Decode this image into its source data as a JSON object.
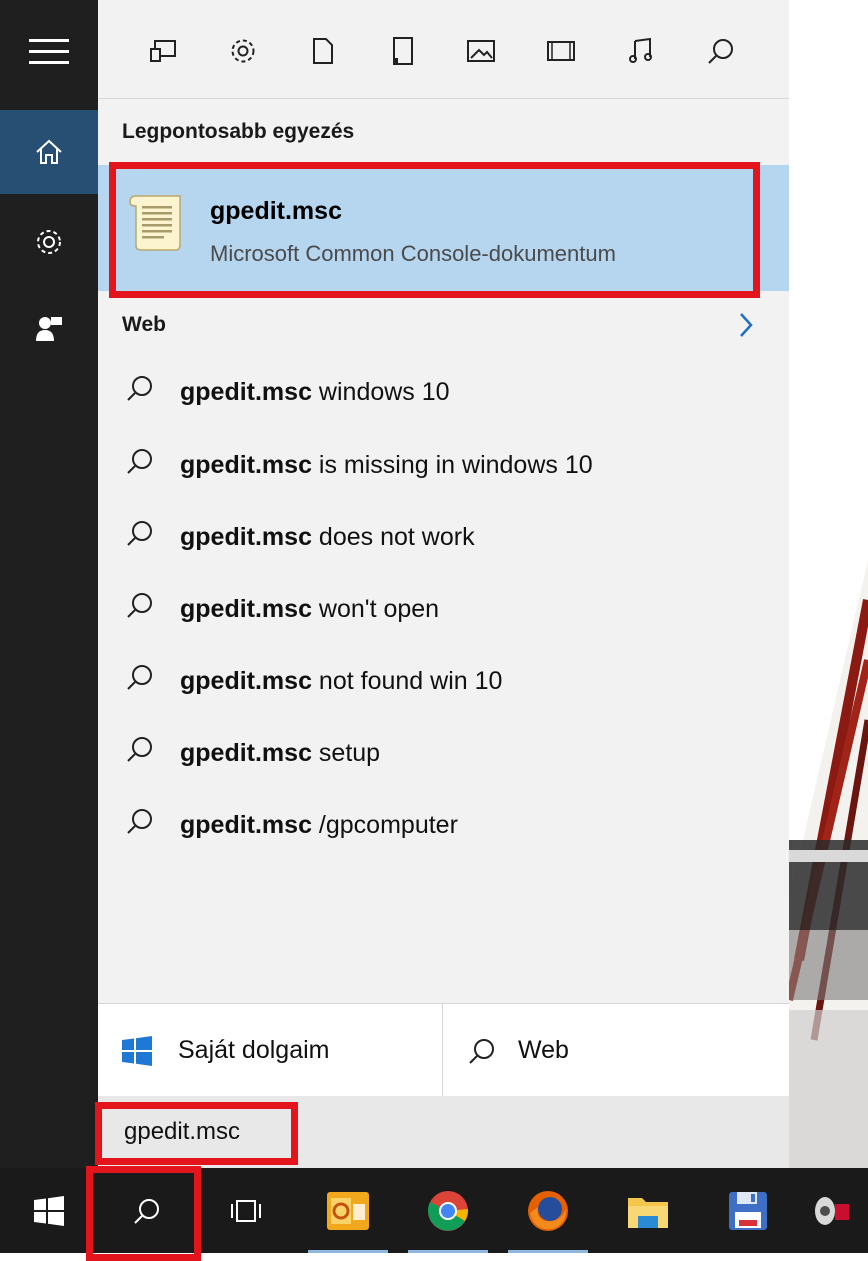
{
  "rail": {
    "items": [
      {
        "name": "menu",
        "icon": "hamburger-icon"
      },
      {
        "name": "home",
        "icon": "home-icon",
        "active": true
      },
      {
        "name": "settings",
        "icon": "gear-icon"
      },
      {
        "name": "feedback",
        "icon": "feedback-icon"
      }
    ]
  },
  "filters": [
    "apps-icon",
    "settings-icon",
    "document-icon",
    "folder-icon",
    "photo-icon",
    "video-icon",
    "music-icon",
    "search-icon"
  ],
  "best_match": {
    "heading": "Legpontosabb egyezés",
    "title": "gpedit.msc",
    "subtitle": "Microsoft Common Console-dokumentum"
  },
  "web": {
    "heading": "Web",
    "suggestions": [
      {
        "bold": "gpedit.msc",
        "rest": " windows 10"
      },
      {
        "bold": "gpedit.msc",
        "rest": " is missing in windows 10"
      },
      {
        "bold": "gpedit.msc",
        "rest": " does not work"
      },
      {
        "bold": "gpedit.msc",
        "rest": " won't open"
      },
      {
        "bold": "gpedit.msc",
        "rest": " not found win 10"
      },
      {
        "bold": "gpedit.msc",
        "rest": " setup"
      },
      {
        "bold": "gpedit.msc",
        "rest": " /gpcomputer"
      }
    ]
  },
  "bottom": {
    "my_stuff_label": "Saját dolgaim",
    "web_label": "Web"
  },
  "searchbox": {
    "value": "gpedit.msc"
  },
  "colors": {
    "accent": "#264f73",
    "selection": "#b6d6f0",
    "highlight": "#e3141b"
  }
}
